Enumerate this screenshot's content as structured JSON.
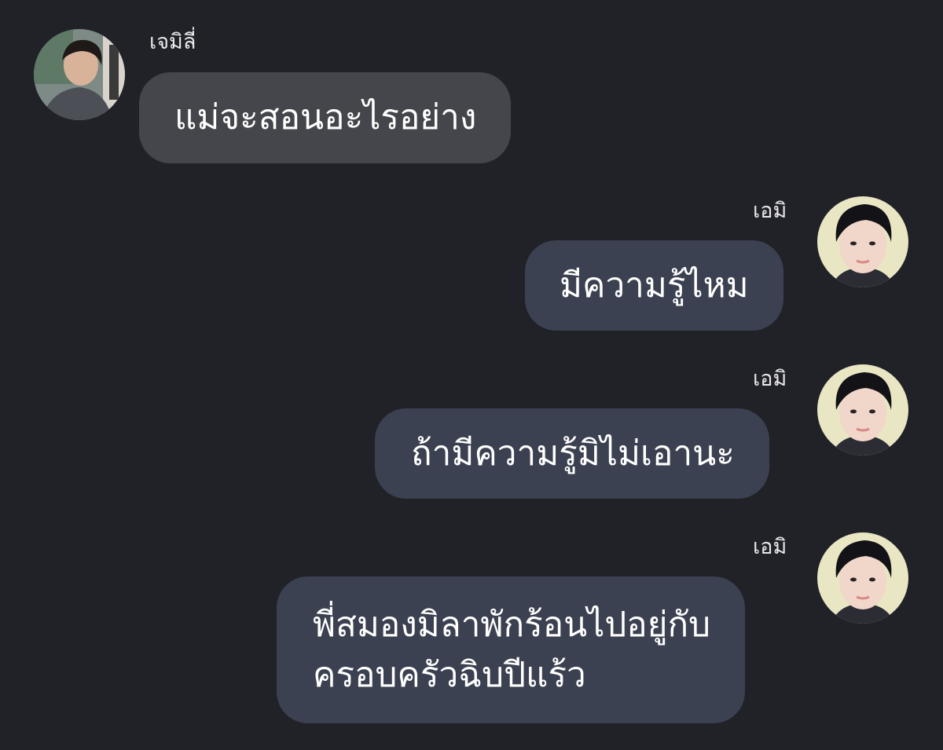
{
  "messages": [
    {
      "direction": "incoming",
      "sender": "เจมิลี่",
      "avatar_icon": "profile-photo-icon",
      "lines": [
        "แม่จะสอนอะไรอย่าง"
      ]
    },
    {
      "direction": "outgoing",
      "sender": "เอมิ",
      "avatar_icon": "profile-photo-icon",
      "lines": [
        "มีความรู้ไหม"
      ]
    },
    {
      "direction": "outgoing",
      "sender": "เอมิ",
      "avatar_icon": "profile-photo-icon",
      "lines": [
        "ถ้ามีความรู้มิไม่เอานะ"
      ]
    },
    {
      "direction": "outgoing",
      "sender": "เอมิ",
      "avatar_icon": "profile-photo-icon",
      "lines": [
        "พี่สมองมิลาพักร้อนไปอยู่กับ",
        "ครอบครัวฉิบปีแร้ว"
      ]
    }
  ],
  "colors": {
    "background": "#212228",
    "incoming_bubble": "#45464b",
    "outgoing_bubble": "#3b4150",
    "text": "#ffffff"
  }
}
